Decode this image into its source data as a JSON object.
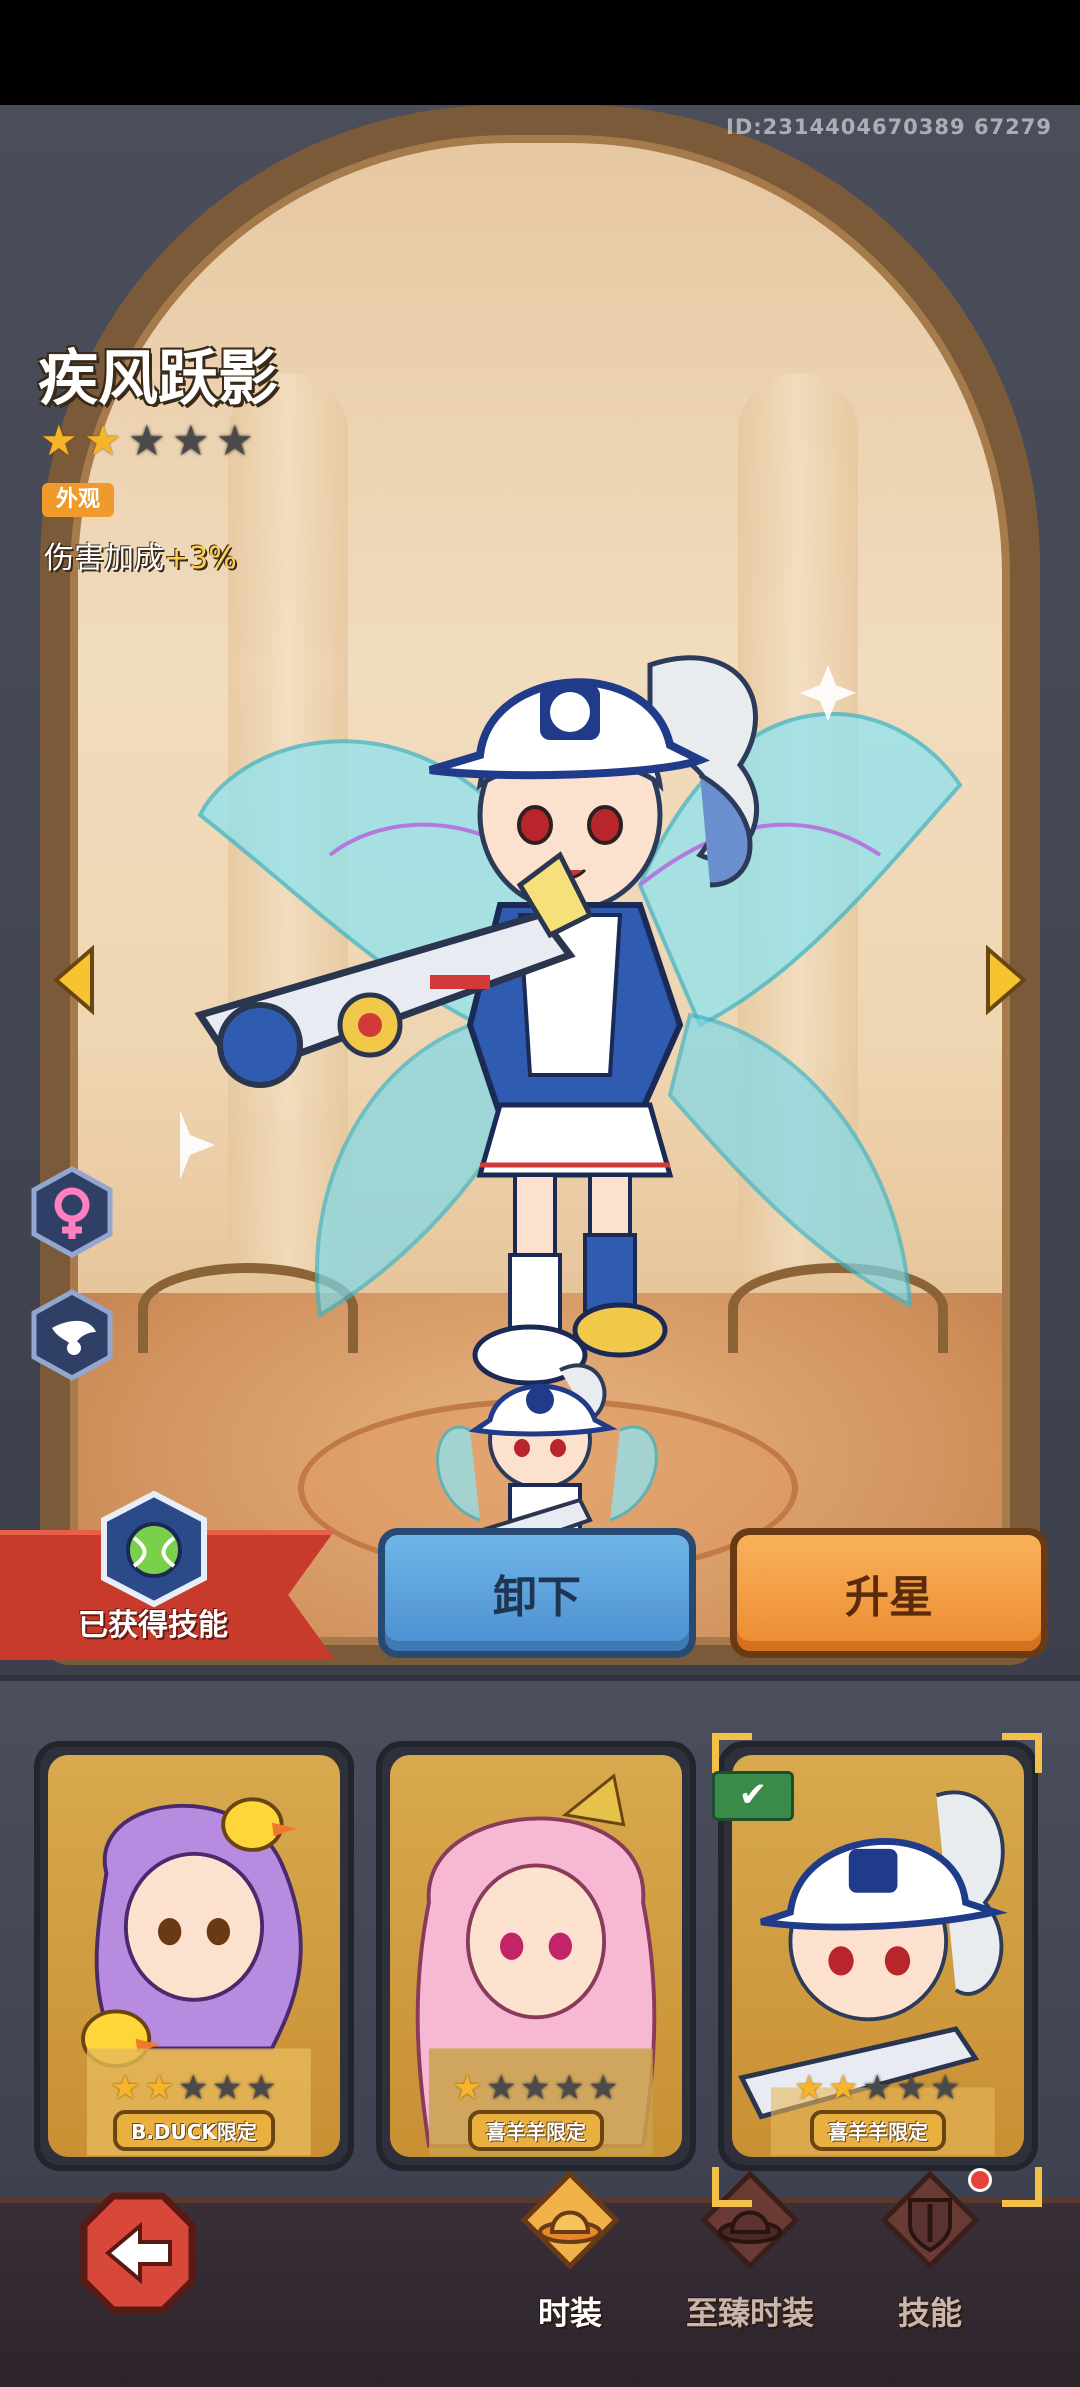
{
  "header": {
    "uid": "ID:2314404670389 67279"
  },
  "skin": {
    "name": "疾风跃影",
    "stars_total": 5,
    "stars_filled": 2,
    "tag": "外观",
    "bonus_label": "伤害加成",
    "bonus_value": "+3%"
  },
  "actions": {
    "skill_label": "已获得技能",
    "unequip_label": "卸下",
    "starup_label": "升星"
  },
  "skins_list": [
    {
      "stars_filled": 2,
      "stars_total": 5,
      "ribbon": "B.DUCK限定",
      "selected": false
    },
    {
      "stars_filled": 1,
      "stars_total": 5,
      "ribbon": "喜羊羊限定",
      "selected": false
    },
    {
      "stars_filled": 2,
      "stars_total": 5,
      "ribbon": "喜羊羊限定",
      "selected": true
    }
  ],
  "bottom_nav": {
    "tabs": [
      {
        "label": "时装",
        "active": true
      },
      {
        "label": "至臻时装",
        "active": false
      },
      {
        "label": "技能",
        "active": false
      }
    ]
  },
  "colors": {
    "accent_orange": "#ec8a30",
    "accent_blue": "#4b8fd0",
    "banner_red": "#c83a2c",
    "star_gold": "#f5b42a"
  }
}
